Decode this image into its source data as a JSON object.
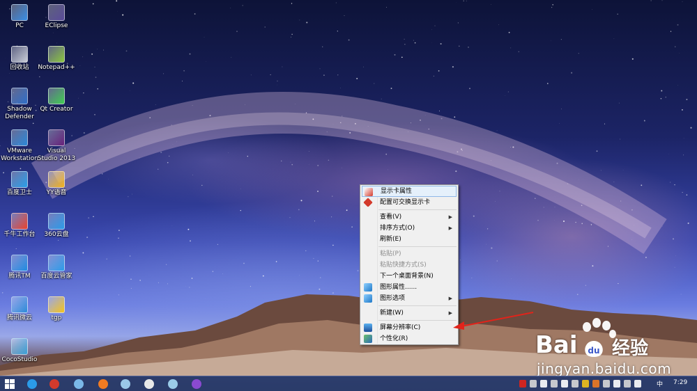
{
  "desktop": {
    "icons": [
      {
        "label": "PC",
        "icon": "computer-icon",
        "color": "#3a8ee6"
      },
      {
        "label": "EClipse",
        "icon": "eclipse-icon",
        "color": "#5a4b9a"
      },
      {
        "label": "回收站",
        "icon": "recycle-bin-icon",
        "color": "#c8ccd6"
      },
      {
        "label": "Notepad++",
        "icon": "notepadpp-icon",
        "color": "#8cc63f"
      },
      {
        "label": "Shadow Defender",
        "icon": "shadow-defender-icon",
        "color": "#2f6fc9"
      },
      {
        "label": "Qt Creator",
        "icon": "qt-creator-icon",
        "color": "#41cd52"
      },
      {
        "label": "VMware Workstation",
        "icon": "vmware-icon",
        "color": "#2b88d8"
      },
      {
        "label": "Visual Studio 2013",
        "icon": "visual-studio-icon",
        "color": "#68217a"
      },
      {
        "label": "百度卫士",
        "icon": "baidu-guard-icon",
        "color": "#2aa0e8"
      },
      {
        "label": "YY语音",
        "icon": "yy-voice-icon",
        "color": "#f2b21b"
      },
      {
        "label": "千牛工作台",
        "icon": "qianniu-icon",
        "color": "#e8432d"
      },
      {
        "label": "360云盘",
        "icon": "cloud-disk-360-icon",
        "color": "#2b9be8"
      },
      {
        "label": "腾讯TM",
        "icon": "tencent-tm-icon",
        "color": "#1e8be0"
      },
      {
        "label": "百度云管家",
        "icon": "baidu-cloud-icon",
        "color": "#2b9be8"
      },
      {
        "label": "腾讯微云",
        "icon": "weiyun-icon",
        "color": "#2a8ad8"
      },
      {
        "label": "tgp",
        "icon": "tgp-icon",
        "color": "#f2c21b"
      },
      {
        "label": "CocoStudio",
        "icon": "cocostudio-icon",
        "color": "#3aa0d8"
      }
    ]
  },
  "context_menu": {
    "items": [
      {
        "type": "item",
        "label": "显示卡属性",
        "icon": "graphics-properties-icon",
        "hover": true
      },
      {
        "type": "item",
        "label": "配置可交换显示卡",
        "icon": "switchable-graphics-icon"
      },
      {
        "type": "sep"
      },
      {
        "type": "item",
        "label": "查看(V)",
        "submenu": true
      },
      {
        "type": "item",
        "label": "排序方式(O)",
        "submenu": true
      },
      {
        "type": "item",
        "label": "刷新(E)"
      },
      {
        "type": "sep"
      },
      {
        "type": "item",
        "label": "粘贴(P)",
        "disabled": true
      },
      {
        "type": "item",
        "label": "粘贴快捷方式(S)",
        "disabled": true
      },
      {
        "type": "item",
        "label": "下一个桌面背景(N)"
      },
      {
        "type": "item",
        "label": "图形属性......",
        "icon": "intel-graphics-icon"
      },
      {
        "type": "item",
        "label": "图形选项",
        "icon": "intel-graphics-icon",
        "submenu": true
      },
      {
        "type": "sep"
      },
      {
        "type": "item",
        "label": "新建(W)",
        "submenu": true
      },
      {
        "type": "sep"
      },
      {
        "type": "item",
        "label": "屏幕分辨率(C)",
        "icon": "screen-resolution-icon"
      },
      {
        "type": "item",
        "label": "个性化(R)",
        "icon": "personalize-icon"
      }
    ],
    "submenu_arrow": "▶"
  },
  "watermark": {
    "brand": "Bai",
    "brand_tail": "经验",
    "url": "jingyan.baidu.com"
  },
  "taskbar": {
    "pinned": [
      {
        "icon": "windows-start-icon",
        "color": "#ffffff"
      },
      {
        "icon": "internet-explorer-icon",
        "color": "#2b9be8"
      },
      {
        "icon": "photo-viewer-icon",
        "color": "#d33a2c"
      },
      {
        "icon": "globe-icon",
        "color": "#7ab8e8"
      },
      {
        "icon": "firefox-icon",
        "color": "#f07b22"
      },
      {
        "icon": "network-icon",
        "color": "#9ac8e8"
      },
      {
        "icon": "alarm-clock-icon",
        "color": "#e8e8e8"
      },
      {
        "icon": "chat-icon",
        "color": "#9acbe8"
      },
      {
        "icon": "visual-studio-taskbar-icon",
        "color": "#8a4ad0"
      }
    ],
    "tray_icons": [
      "red-arrow-tray-icon",
      "message-tray-icon",
      "bluetooth-icon",
      "network-tray-icon",
      "user-tray-icon",
      "chat-tray-icon",
      "yellow-tray-icon",
      "orange-tray-icon",
      "display-tray-icon",
      "flag-icon",
      "battery-icon",
      "volume-icon"
    ],
    "ime": "中",
    "time": "7:29"
  }
}
